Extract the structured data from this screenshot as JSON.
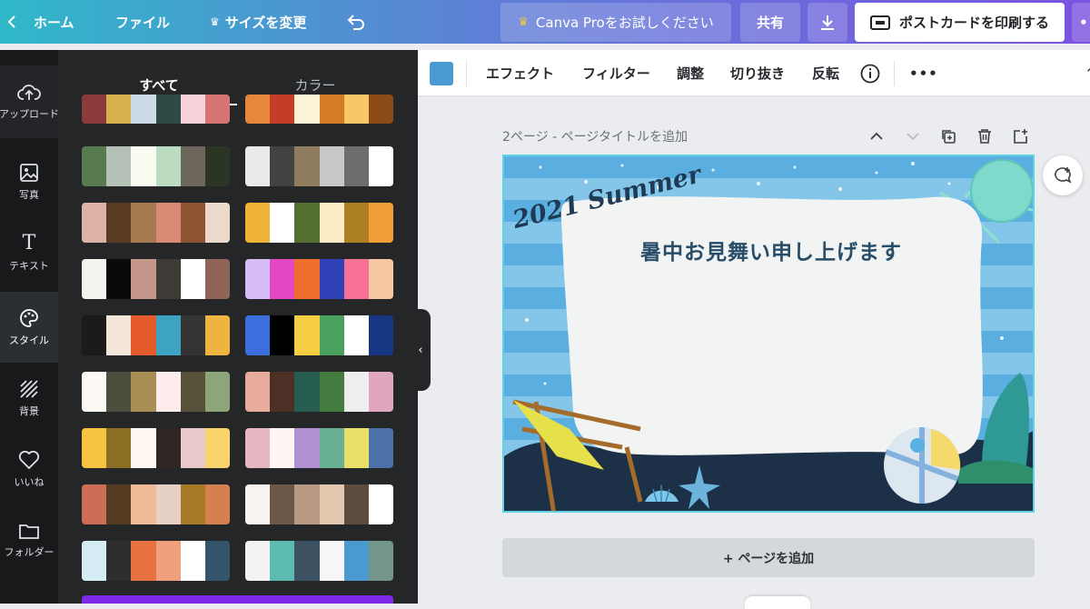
{
  "topbar": {
    "home": "ホーム",
    "file": "ファイル",
    "resize": "サイズを変更",
    "try_pro": "Canva Proをお試しください",
    "share": "共有",
    "print": "ポストカードを印刷する",
    "more": "•"
  },
  "rail": [
    {
      "label": "アップロード",
      "icon": "upload-cloud-icon"
    },
    {
      "label": "写真",
      "icon": "photo-icon"
    },
    {
      "label": "テキスト",
      "icon": "text-icon"
    },
    {
      "label": "スタイル",
      "icon": "palette-icon"
    },
    {
      "label": "背景",
      "icon": "background-pattern-icon"
    },
    {
      "label": "いいね",
      "icon": "heart-icon"
    },
    {
      "label": "フォルダー",
      "icon": "folder-icon"
    }
  ],
  "panel": {
    "tabs": [
      "すべて",
      "カラー"
    ],
    "palettes_left": [
      [
        "#8a3b3a",
        "#d9b04e",
        "#ccdbe6",
        "#2e4a44",
        "#f6d2da",
        "#d77373"
      ],
      [
        "#587a50",
        "#b5c1b6",
        "#f7fbf0",
        "#bcdcc1",
        "#6c665c",
        "#2a3524"
      ],
      [
        "#ddb3a7",
        "#593c22",
        "#a67a4f",
        "#d88a74",
        "#8e5533",
        "#ebdacb"
      ],
      [
        "#f5f3ee",
        "#0a0a0a",
        "#c4978a",
        "#3e3b37",
        "#ffffff",
        "#906558"
      ],
      [
        "#1c1a1b",
        "#f3e6d8",
        "#e55a2b",
        "#3ea3c1",
        "#343434",
        "#efb33f"
      ],
      [
        "#fcf8f3",
        "#4a4e3c",
        "#a88d55",
        "#fcecec",
        "#575239",
        "#8ea57a"
      ],
      [
        "#f6c441",
        "#8c6d24",
        "#fff7f1",
        "#2f2522",
        "#e7c9c9",
        "#f8d46b"
      ],
      [
        "#cb6e55",
        "#563d22",
        "#f0bb98",
        "#e6d1c4",
        "#a67a24",
        "#d67f51"
      ],
      [
        "#d5ecf4",
        "#2d2d2d",
        "#e8723f",
        "#f1a07e",
        "#ffffff",
        "#34546c"
      ]
    ],
    "palettes_right": [
      [
        "#e6873b",
        "#c43d27",
        "#fbf3d7",
        "#d47b23",
        "#f8c767",
        "#8c4a16"
      ],
      [
        "#eaeaea",
        "#424242",
        "#8f7b5d",
        "#c8c8c8",
        "#6d6d6d",
        "#ffffff"
      ],
      [
        "#efb338",
        "#ffffff",
        "#556f32",
        "#fbecc6",
        "#ac7f25",
        "#ef9d35"
      ],
      [
        "#d6bdf6",
        "#e448c4",
        "#ef6d2e",
        "#2f41b7",
        "#f67193",
        "#f6c6a1"
      ],
      [
        "#3c6ee0",
        "#000000",
        "#f6ce43",
        "#4aa15d",
        "#ffffff",
        "#163682"
      ],
      [
        "#e8ac9c",
        "#4c2f25",
        "#275d4f",
        "#447c3f",
        "#eeeeee",
        "#e0a6bd"
      ],
      [
        "#e8b8c2",
        "#fff5f2",
        "#b090d0",
        "#69b095",
        "#e8e06a",
        "#4b71a8"
      ],
      [
        "#f7f4ef",
        "#6b5847",
        "#b89984",
        "#e2c6ad",
        "#5b4c3f",
        "#ffffff"
      ],
      [
        "#f3f3f3",
        "#5dbcb1",
        "#3c5263",
        "#f6f6f6",
        "#4a99cf",
        "#74958a"
      ]
    ]
  },
  "ctxbar": {
    "color": "#4a9bd1",
    "effects": "エフェクト",
    "filter": "フィルター",
    "adjust": "調整",
    "crop": "切り抜き",
    "flip": "反転",
    "more": "•••"
  },
  "page": {
    "header": "2ページ - ページタイトルを追加",
    "add_page": "+ ページを追加"
  },
  "design": {
    "script_text": "2021 Summer",
    "title_text": "暑中お見舞い申し上げます"
  }
}
